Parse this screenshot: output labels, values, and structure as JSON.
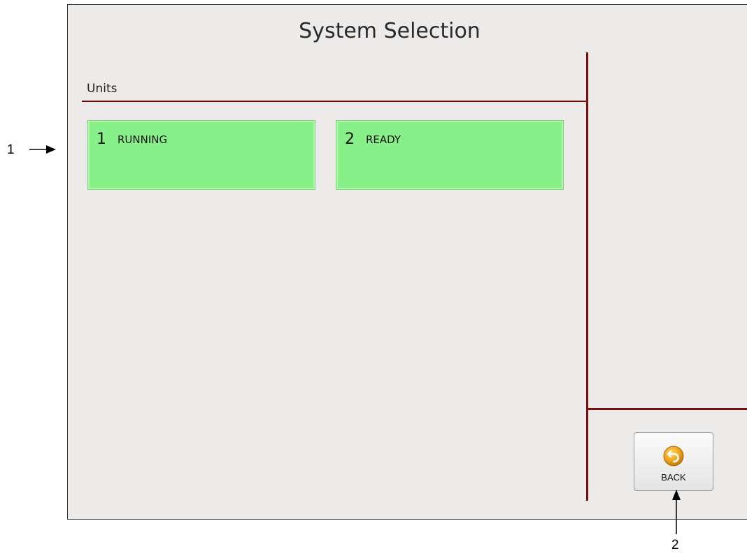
{
  "screen": {
    "title": "System Selection",
    "section_label": "Units",
    "units": [
      {
        "number": "1",
        "state": "RUNNING",
        "status_color": "#88f088"
      },
      {
        "number": "2",
        "state": "READY",
        "status_color": "#88f088"
      }
    ],
    "back_button": {
      "label": "BACK",
      "icon": "back-arrow-icon"
    }
  },
  "callouts": {
    "one": "1",
    "two": "2"
  },
  "colors": {
    "divider": "#7a0d0d",
    "background": "#edebea",
    "unit_green": "#88f088",
    "icon_orange": "#f0a51e"
  }
}
